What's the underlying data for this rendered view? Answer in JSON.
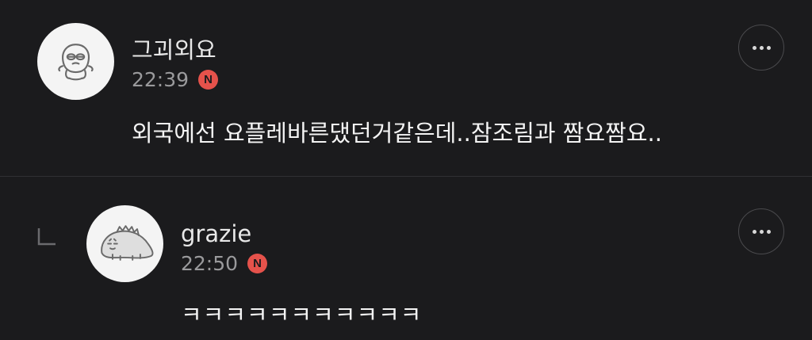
{
  "comments": [
    {
      "author": "그괴외요",
      "time": "22:39",
      "badge": "N",
      "text": "외국에선 요플레바른댔던거같은데..잠조림과 짬요짬요..",
      "avatar_icon": "cartoon-character-icon"
    },
    {
      "author": "grazie",
      "time": "22:50",
      "badge": "N",
      "text": "ㅋㅋㅋㅋㅋㅋㅋㅋㅋㅋㅋ",
      "avatar_icon": "cartoon-dinosaur-icon",
      "is_reply": true
    }
  ],
  "colors": {
    "background": "#1b1b1d",
    "badge": "#e5524b",
    "divider": "#303033",
    "timestamp": "#9a9a9c"
  },
  "icons": {
    "more": "more-options-icon",
    "reply": "reply-arrow-icon"
  }
}
